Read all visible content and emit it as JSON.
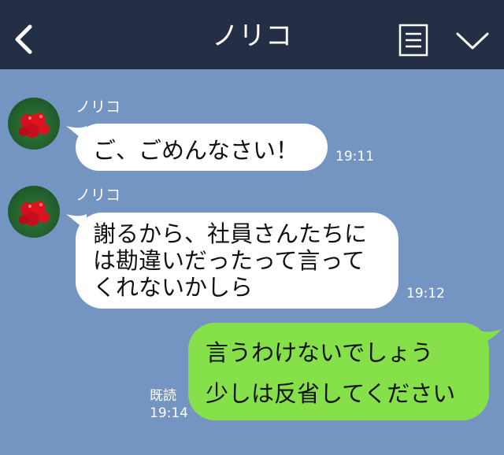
{
  "header": {
    "title": "ノリコ",
    "back_icon": "chevron-left-icon",
    "menu_icon": "menu-icon",
    "collapse_icon": "chevron-down-icon",
    "bar_color": "#242f45"
  },
  "chat": {
    "background_color": "#7494c2",
    "incoming_bubble_color": "#ffffff",
    "outgoing_bubble_color": "#86e04a",
    "messages": [
      {
        "direction": "incoming",
        "sender": "ノリコ",
        "lines": [
          "ご、ごめんなさい！"
        ],
        "time": "19:11"
      },
      {
        "direction": "incoming",
        "sender": "ノリコ",
        "lines": [
          "謝るから、社員さんたちに",
          "は勘違いだったって言って",
          "くれないかしら"
        ],
        "time": "19:12"
      },
      {
        "direction": "outgoing",
        "lines": [
          "言うわけないでしょう",
          "少しは反省してください"
        ],
        "read_label": "既読",
        "time": "19:14"
      }
    ]
  }
}
